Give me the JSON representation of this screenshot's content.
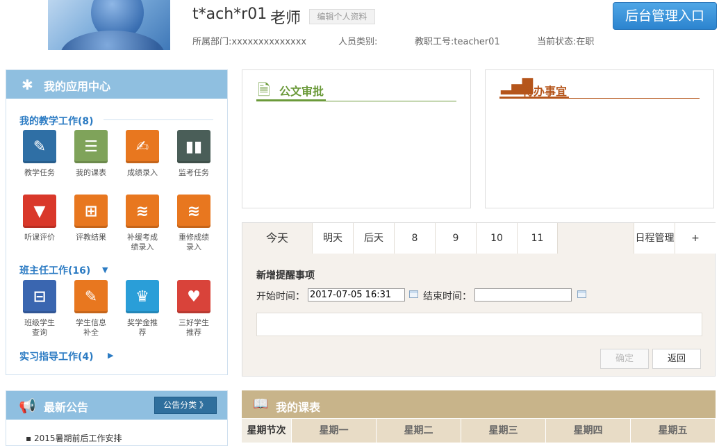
{
  "header": {
    "username": "t*ach*r01",
    "role": "老师",
    "edit_profile": "编辑个人资料",
    "department": "所属部门:xxxxxxxxxxxxxx",
    "staff_type": "人员类别:",
    "staff_id": "教职工号:teacher01",
    "status": "当前状态:在职",
    "admin_button": "后台管理入口"
  },
  "app_center": {
    "title": "我的应用中心",
    "teaching_section": "我的教学工作(8)",
    "teaching_apps": [
      {
        "label": "教学任务",
        "color": "#2f6fa5",
        "icon": "pencil-icon"
      },
      {
        "label": "我的课表",
        "color": "#7fa35a",
        "icon": "list-icon"
      },
      {
        "label": "成绩录入",
        "color": "#e8771f",
        "icon": "notes-icon"
      },
      {
        "label": "监考任务",
        "color": "#4a5e58",
        "icon": "binder-icon"
      },
      {
        "label": "听课评价",
        "color": "#d9382a",
        "icon": "bookmark-icon"
      },
      {
        "label": "评教结果",
        "color": "#e8771f",
        "icon": "calculator-icon"
      },
      {
        "label": "补缓考成绩录入",
        "color": "#e8771f",
        "icon": "layers-icon"
      },
      {
        "label": "重修成绩录入",
        "color": "#e8771f",
        "icon": "layers-icon"
      }
    ],
    "homeroom_section": "班主任工作(16)",
    "homeroom_apps": [
      {
        "label": "班级学生查询",
        "color": "#3a66b0",
        "icon": "inbox-icon"
      },
      {
        "label": "学生信息补全",
        "color": "#e8771f",
        "icon": "pencil-icon"
      },
      {
        "label": "奖学金推荐",
        "color": "#2a9ed8",
        "icon": "trophy-icon"
      },
      {
        "label": "三好学生推荐",
        "color": "#d9433a",
        "icon": "heart-icon"
      }
    ],
    "internship_section": "实习指导工作(4)"
  },
  "notices": {
    "title": "最新公告",
    "category_button": "公告分类 》",
    "items": [
      "2015暑期前后工作安排"
    ]
  },
  "doc_approval": {
    "title": "公文审批",
    "accent": "#6b9a3a"
  },
  "todo": {
    "title": "待办事宜",
    "accent": "#b5551b"
  },
  "schedule": {
    "tabs": [
      "今天",
      "明天",
      "后天",
      "8",
      "9",
      "10",
      "11"
    ],
    "manage": "日程管理",
    "add": "+",
    "form_title": "新增提醒事项",
    "start_label": "开始时间：",
    "start_value": "2017-07-05 16:31",
    "end_label": "结束时间：",
    "end_value": "",
    "confirm": "确定",
    "back": "返回"
  },
  "timetable": {
    "title": "我的课表",
    "columns": [
      "星期节次",
      "星期一",
      "星期二",
      "星期三",
      "星期四",
      "星期五"
    ]
  }
}
